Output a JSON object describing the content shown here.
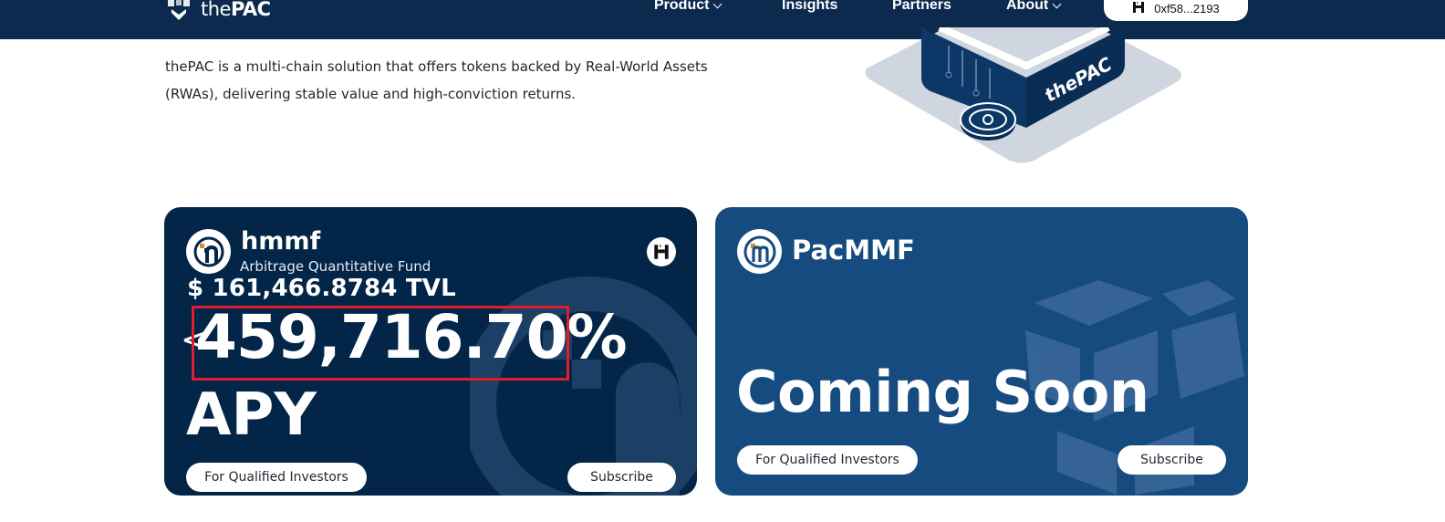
{
  "nav": {
    "brand_prefix": "the",
    "brand_name": "PAC",
    "links": [
      {
        "label": "Product",
        "has_dropdown": true
      },
      {
        "label": "Insights",
        "has_dropdown": false
      },
      {
        "label": "Partners",
        "has_dropdown": false
      },
      {
        "label": "About",
        "has_dropdown": true
      }
    ],
    "wallet": {
      "address": "0xf58...2193",
      "icon": "hmmf-chain-icon"
    }
  },
  "hero": {
    "description": "thePAC is a multi-chain solution that offers tokens backed by Real-World Assets (RWAs), delivering stable value and high-conviction returns.",
    "art_label": "thePAC"
  },
  "cards": [
    {
      "name": "hmmf",
      "subtitle": "Arbitrage Quantitative Fund",
      "tvl": "$ 161,466.8784 TVL",
      "apy_value": "459,716.70%",
      "apy_prefix": "<",
      "apy_label": "APY",
      "investors_label": "For Qualified Investors",
      "subscribe_label": "Subscribe",
      "chain_icon": "hmmf-chain-icon",
      "colors": {
        "background": "#022548"
      }
    },
    {
      "name": "PacMMF",
      "status": "Coming Soon",
      "investors_label": "For Qualified Investors",
      "subscribe_label": "Subscribe",
      "colors": {
        "background": "#164b80"
      }
    }
  ],
  "colors": {
    "nav_bg": "#0b2a4e",
    "highlight": "#e01e2a"
  }
}
